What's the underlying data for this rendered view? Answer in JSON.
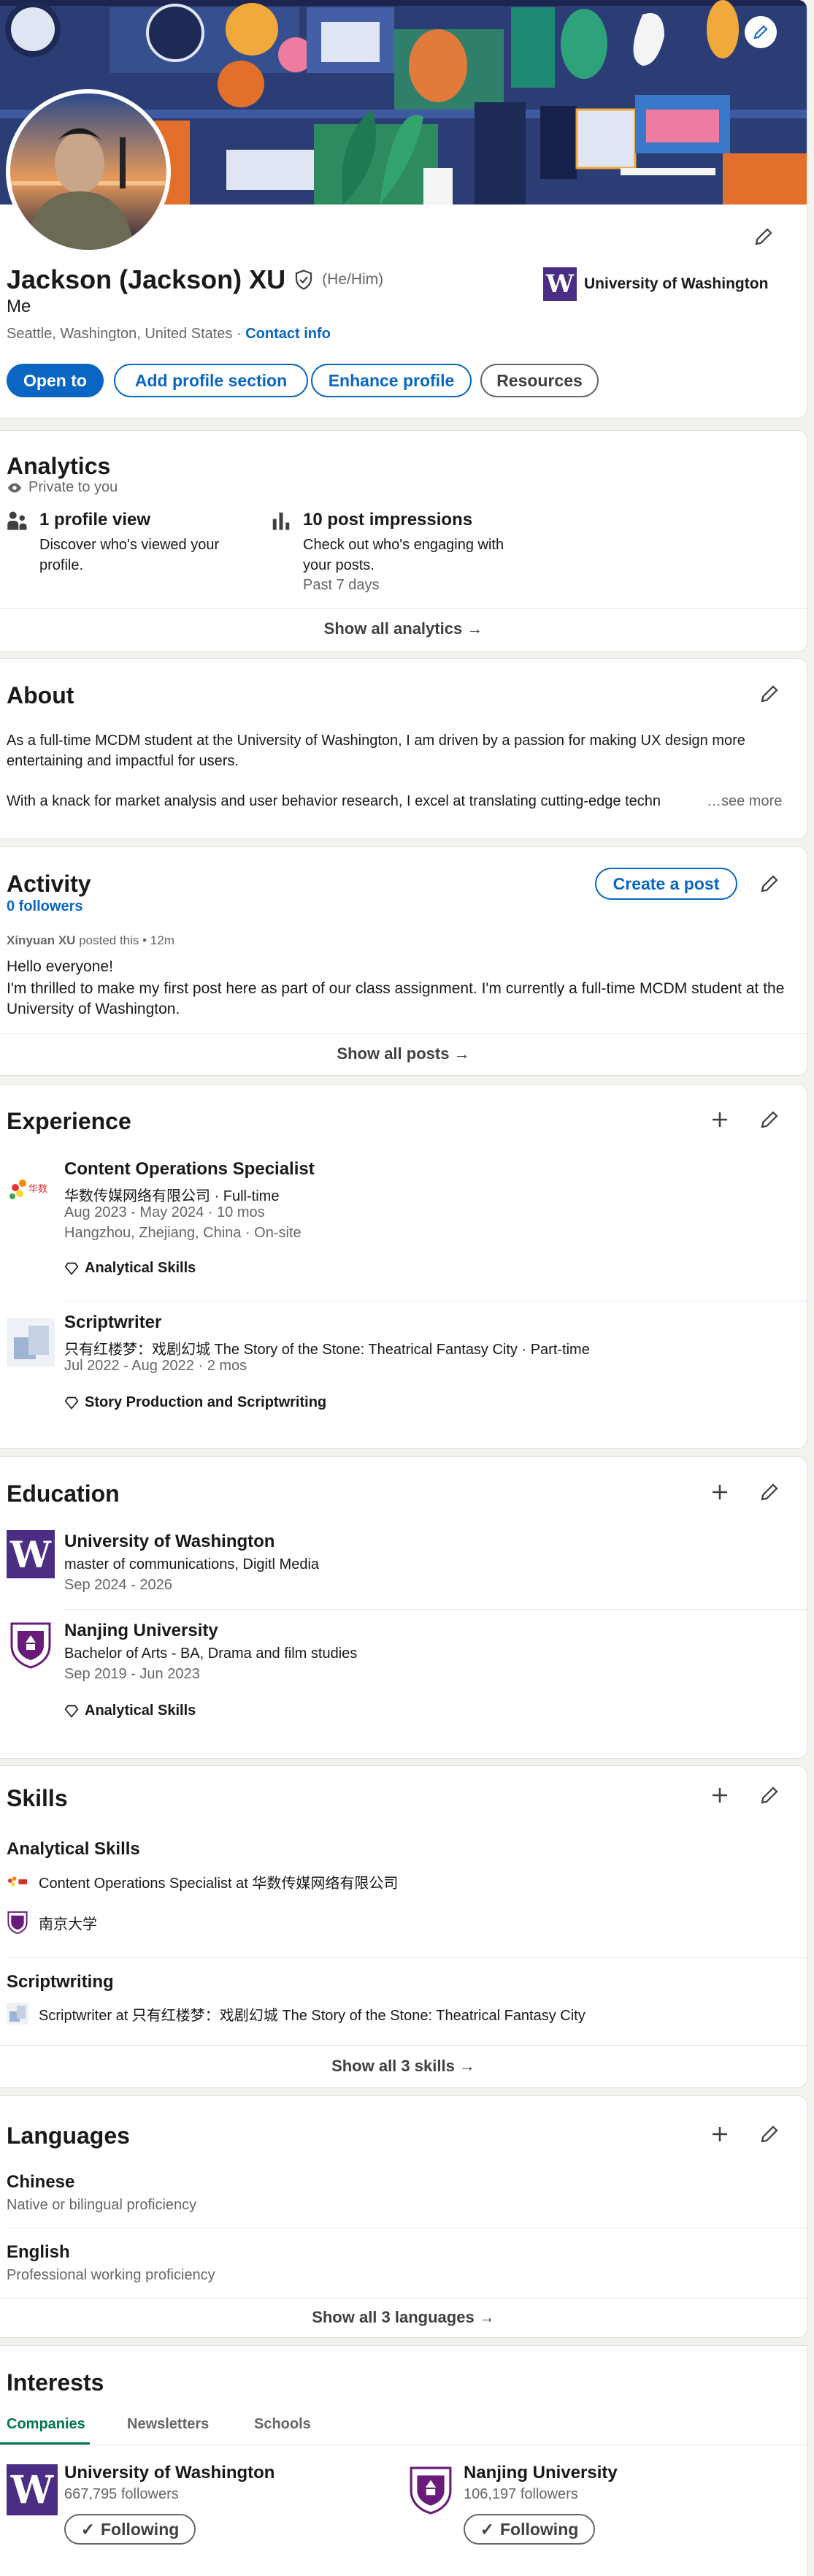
{
  "profile": {
    "name": "Jackson (Jackson) XU",
    "pronouns": "(He/Him)",
    "headline": "Me",
    "location": "Seattle, Washington, United States",
    "contact_sep": "·",
    "contact_link": "Contact info",
    "school": "University of Washington",
    "buttons": [
      "Open to",
      "Add profile section",
      "Enhance profile",
      "Resources"
    ]
  },
  "analytics": {
    "title": "Analytics",
    "privacy": "Private to you",
    "items": [
      {
        "title": "1 profile view",
        "desc": "Discover who's viewed your profile.",
        "extra": ""
      },
      {
        "title": "10 post impressions",
        "desc": "Check out who's engaging with your posts.",
        "extra": "Past 7 days"
      }
    ],
    "show_all": "Show all analytics →"
  },
  "about": {
    "title": "About",
    "p1": "As a full-time MCDM student at the University of Washington, I am driven by a passion for making UX design more entertaining and impactful for users.",
    "p2": "With a knack for market analysis and user behavior research, I excel at translating cutting-edge techn",
    "see_more": "…see more"
  },
  "activity": {
    "title": "Activity",
    "followers": "0 followers",
    "create_post": "Create a post",
    "author": "Xinyuan XU",
    "posted_meta": " posted this • 12m",
    "line1": "Hello everyone!",
    "line2": "I'm thrilled to make my first post here as part of our class assignment. I'm currently a full-time MCDM student at the University of Washington.",
    "show_all": "Show all posts →"
  },
  "experience": {
    "title": "Experience",
    "items": [
      {
        "role": "Content Operations Specialist",
        "company": "华数传媒网络有限公司 · Full-time",
        "dates": "Aug 2023 - May 2024 · 10 mos",
        "place": "Hangzhou, Zhejiang, China · On-site",
        "skill": "Analytical Skills",
        "logo_text": "华数"
      },
      {
        "role": "Scriptwriter",
        "company": "只有红楼梦：戏剧幻城 The Story of the Stone: Theatrical Fantasy City · Part-time",
        "dates": "Jul 2022 - Aug 2022 · 2 mos",
        "place": "",
        "skill": "Story Production and Scriptwriting",
        "logo_text": ""
      }
    ]
  },
  "education": {
    "title": "Education",
    "items": [
      {
        "school": "University of Washington",
        "degree": "master of communications, Digitl Media",
        "dates": "Sep 2024 - 2026",
        "skill": ""
      },
      {
        "school": "Nanjing University",
        "degree": "Bachelor of Arts - BA, Drama and film studies",
        "dates": "Sep 2019 - Jun 2023",
        "skill": "Analytical Skills"
      }
    ]
  },
  "skills": {
    "title": "Skills",
    "items": [
      {
        "name": "Analytical Skills",
        "lines": [
          "Content Operations Specialist at 华数传媒网络有限公司",
          "南京大学"
        ]
      },
      {
        "name": "Scriptwriting",
        "lines": [
          "Scriptwriter at 只有红楼梦：戏剧幻城 The Story of the Stone: Theatrical Fantasy City"
        ]
      }
    ],
    "show_all": "Show all 3 skills →"
  },
  "languages": {
    "title": "Languages",
    "items": [
      {
        "name": "Chinese",
        "level": "Native or bilingual proficiency"
      },
      {
        "name": "English",
        "level": "Professional working proficiency"
      }
    ],
    "show_all": "Show all 3 languages →"
  },
  "interests": {
    "title": "Interests",
    "tabs": [
      "Companies",
      "Newsletters",
      "Schools"
    ],
    "items": [
      {
        "name": "University of Washington",
        "followers": "667,795 followers",
        "button": "Following"
      },
      {
        "name": "Nanjing University",
        "followers": "106,197 followers",
        "button": "Following"
      }
    ]
  },
  "colors": {
    "accent": "#0a66c2",
    "uw_purple": "#4b2e83",
    "nju_purple": "#6a1b7a"
  },
  "icons": [
    "pencil-icon",
    "plus-icon",
    "eye-icon",
    "people-icon",
    "bar-chart-icon",
    "diamond-icon",
    "verified-icon",
    "checkmark-icon"
  ]
}
